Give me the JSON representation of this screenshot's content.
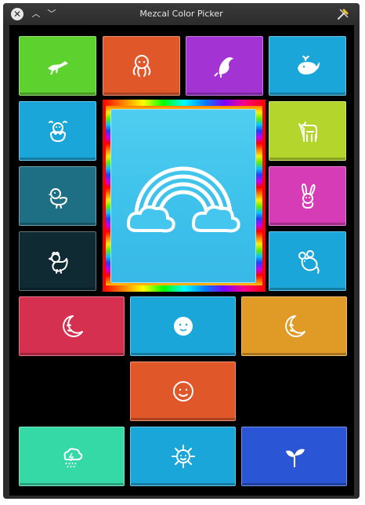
{
  "window": {
    "title": "Mezcal Color Picker",
    "close_glyph": "✕",
    "minimize_glyph": "︿",
    "maximize_glyph": "﹀"
  },
  "tiles": [
    {
      "id": "alligator",
      "icon": "alligator-icon",
      "color": "#5dd12e"
    },
    {
      "id": "octopus",
      "icon": "octopus-icon",
      "color": "#e0582a"
    },
    {
      "id": "dolphin",
      "icon": "dolphin-icon",
      "color": "#a433d4"
    },
    {
      "id": "whale",
      "icon": "whale-icon",
      "color": "#1ba6d9"
    },
    {
      "id": "hatching-chick",
      "icon": "hatching-chick-icon",
      "color": "#1ba6d9"
    },
    {
      "id": "ox",
      "icon": "ox-icon",
      "color": "#b4d62c"
    },
    {
      "id": "baby-chick",
      "icon": "baby-chick-icon",
      "color": "#1e6f84"
    },
    {
      "id": "rabbit",
      "icon": "rabbit-icon",
      "color": "#d63cb6"
    },
    {
      "id": "rooster",
      "icon": "rooster-icon",
      "color": "#0f2a33"
    },
    {
      "id": "mouse",
      "icon": "mouse-icon",
      "color": "#1ba6d9"
    },
    {
      "id": "moon-crescent-left",
      "icon": "crescent-moon-face-icon",
      "color": "#d63050"
    },
    {
      "id": "full-moon",
      "icon": "full-moon-face-icon",
      "color": "#1ba6d9"
    },
    {
      "id": "moon-crescent-right",
      "icon": "crescent-moon-face-icon",
      "color": "#e09a26"
    },
    {
      "id": "sun-face",
      "icon": "sun-face-icon",
      "color": "#e0582a"
    },
    {
      "id": "storm",
      "icon": "thunder-cloud-icon",
      "color": "#34d9a6"
    },
    {
      "id": "sun",
      "icon": "sun-icon",
      "color": "#1ba6d9"
    },
    {
      "id": "seedling",
      "icon": "seedling-icon",
      "color": "#2a55d4"
    }
  ],
  "selected": {
    "id": "rainbow",
    "icon": "rainbow-icon",
    "color": "#44c6ee"
  },
  "app_icon": "color-picker-icon"
}
